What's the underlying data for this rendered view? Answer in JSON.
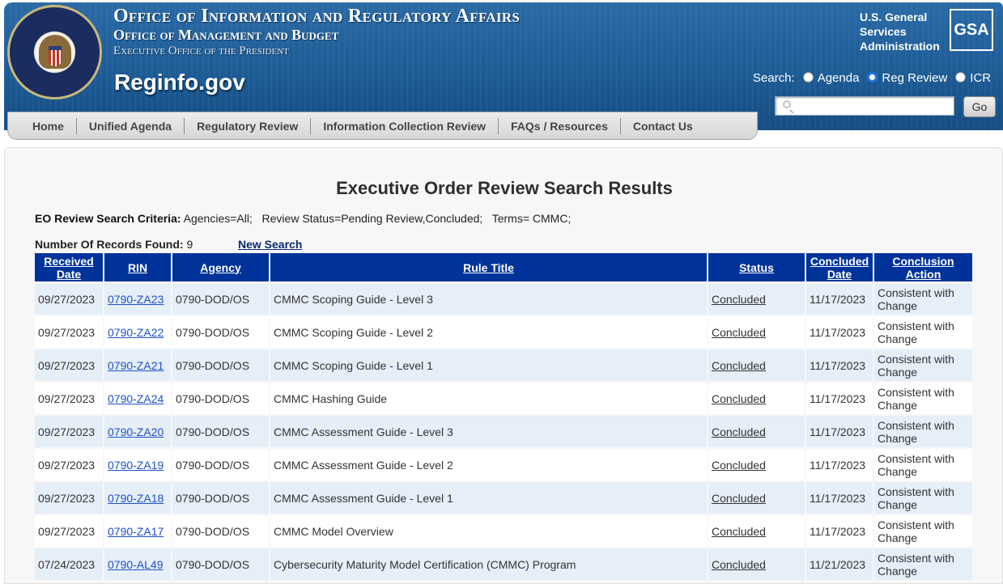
{
  "header": {
    "title_line1": "Office of Information and Regulatory Affairs",
    "title_line2": "Office of Management and Budget",
    "title_line3": "Executive Office of the President",
    "brand": "Reginfo.gov",
    "seal_text": "Executive Office of the President of the United States",
    "gsa_text": "U.S. General Services Administration",
    "gsa_logo": "GSA"
  },
  "search": {
    "label": "Search:",
    "options": [
      "Agenda",
      "Reg Review",
      "ICR"
    ],
    "selected": "Reg Review",
    "go_label": "Go",
    "icon": "magnifier-icon"
  },
  "nav": {
    "items": [
      "Home",
      "Unified Agenda",
      "Regulatory Review",
      "Information Collection Review",
      "FAQs / Resources",
      "Contact Us"
    ]
  },
  "main": {
    "title": "Executive Order Review Search Results",
    "criteria_label": "EO Review Search Criteria:",
    "criteria_value": " Agencies=All;   Review Status=Pending Review,Concluded;   Terms= CMMC;",
    "records_label": "Number Of Records Found:",
    "records_count": " 9",
    "new_search": "New Search",
    "table": {
      "headers": [
        "Received Date",
        "RIN",
        "Agency",
        "Rule Title",
        "Status",
        "Concluded Date",
        "Conclusion Action"
      ],
      "rows": [
        [
          "09/27/2023",
          "0790-ZA23",
          "0790-DOD/OS",
          "CMMC Scoping Guide - Level 3",
          "Concluded",
          "11/17/2023",
          "Consistent with Change"
        ],
        [
          "09/27/2023",
          "0790-ZA22",
          "0790-DOD/OS",
          "CMMC Scoping Guide - Level 2",
          "Concluded",
          "11/17/2023",
          "Consistent with Change"
        ],
        [
          "09/27/2023",
          "0790-ZA21",
          "0790-DOD/OS",
          "CMMC Scoping Guide - Level 1",
          "Concluded",
          "11/17/2023",
          "Consistent with Change"
        ],
        [
          "09/27/2023",
          "0790-ZA24",
          "0790-DOD/OS",
          "CMMC Hashing Guide",
          "Concluded",
          "11/17/2023",
          "Consistent with Change"
        ],
        [
          "09/27/2023",
          "0790-ZA20",
          "0790-DOD/OS",
          "CMMC Assessment Guide - Level 3",
          "Concluded",
          "11/17/2023",
          "Consistent with Change"
        ],
        [
          "09/27/2023",
          "0790-ZA19",
          "0790-DOD/OS",
          "CMMC Assessment Guide - Level 2",
          "Concluded",
          "11/17/2023",
          "Consistent with Change"
        ],
        [
          "09/27/2023",
          "0790-ZA18",
          "0790-DOD/OS",
          "CMMC Assessment Guide - Level 1",
          "Concluded",
          "11/17/2023",
          "Consistent with Change"
        ],
        [
          "09/27/2023",
          "0790-ZA17",
          "0790-DOD/OS",
          "CMMC Model Overview",
          "Concluded",
          "11/17/2023",
          "Consistent with Change"
        ],
        [
          "07/24/2023",
          "0790-AL49",
          "0790-DOD/OS",
          "Cybersecurity Maturity Model Certification (CMMC) Program",
          "Concluded",
          "11/21/2023",
          "Consistent with Change"
        ]
      ]
    }
  },
  "colors": {
    "header_blue": "#1b5891",
    "table_header": "#003399",
    "row_alt": "#e6eef8",
    "link": "#1f51c7"
  }
}
